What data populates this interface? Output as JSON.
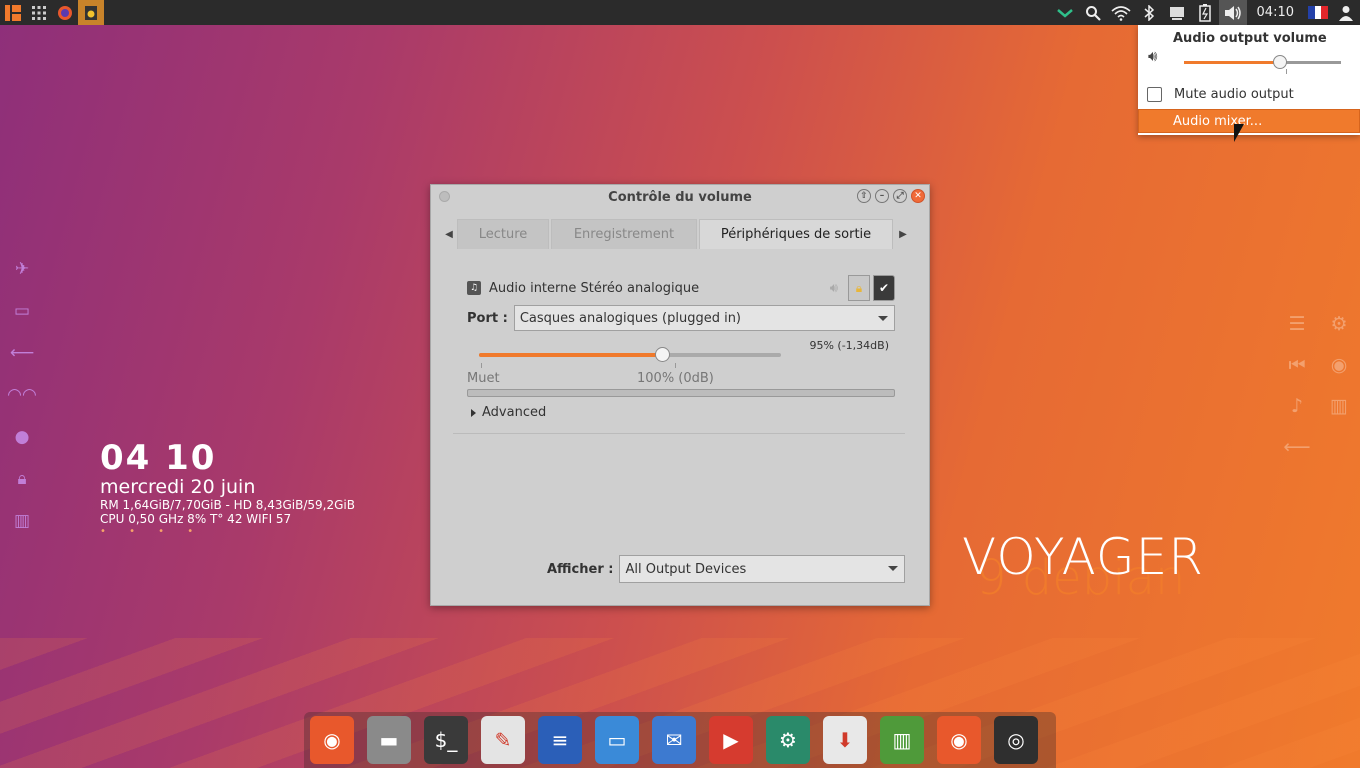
{
  "panel": {
    "clock": "04:10",
    "left_icons": [
      "menu-logo-icon",
      "app-grid-icon",
      "firefox-icon",
      "audio-app-icon"
    ],
    "right_icons": [
      "vpn-check-icon",
      "search-icon",
      "wifi-icon",
      "bluetooth-icon",
      "display-icon",
      "battery-icon",
      "volume-icon"
    ]
  },
  "left_sidebar": {
    "icons": [
      "airplane-icon",
      "monitor-icon",
      "arrow-left-icon",
      "mask-icon",
      "globe-icon",
      "lock-icon",
      "chart-icon"
    ]
  },
  "conky": {
    "time": "04 10",
    "date": "mercredi 20 juin",
    "line1": "RM 1,64GiB/7,70GiB - HD 8,43GiB/59,2GiB",
    "line2": "CPU 0,50 GHz 8% T° 42  WIFI 57",
    "dots": "• • • •"
  },
  "right_sidebar": {
    "icons": [
      [
        "menu-icon",
        "gear-icon"
      ],
      [
        "skip-back-icon",
        "eye-icon"
      ],
      [
        "music-icon",
        "bars-icon"
      ],
      [
        "arrow-left-icon"
      ]
    ]
  },
  "voyager": {
    "line1": "VOYAGER",
    "line2": "9 debian"
  },
  "dock": {
    "apps": [
      {
        "name": "firefox",
        "color": "#e8582c",
        "glyph": "◉"
      },
      {
        "name": "files",
        "color": "#8a8a8a",
        "glyph": "▬"
      },
      {
        "name": "terminal",
        "color": "#3a3a3a",
        "glyph": "$_"
      },
      {
        "name": "text-editor",
        "color": "#e4e4e4",
        "glyph": "✎"
      },
      {
        "name": "writer",
        "color": "#2b5fb8",
        "glyph": "≡"
      },
      {
        "name": "window",
        "color": "#3a8ad8",
        "glyph": "▭"
      },
      {
        "name": "thunderbird",
        "color": "#3d7ad0",
        "glyph": "✉"
      },
      {
        "name": "youtube",
        "color": "#d63b2f",
        "glyph": "▶"
      },
      {
        "name": "settings-tool",
        "color": "#2a8a6a",
        "glyph": "⚙"
      },
      {
        "name": "installer",
        "color": "#e8e8e8",
        "glyph": "⬇"
      },
      {
        "name": "trash",
        "color": "#4f9a3a",
        "glyph": "▥"
      },
      {
        "name": "firefox-2",
        "color": "#e8582c",
        "glyph": "◉"
      },
      {
        "name": "speaker",
        "color": "#2f2f2f",
        "glyph": "◎"
      }
    ]
  },
  "window": {
    "title": "Contrôle du volume",
    "tabs": [
      "Lecture",
      "Enregistrement",
      "Périphériques de sortie"
    ],
    "device_name": "Audio interne Stéréo analogique",
    "port_label": "Port :",
    "port_value": "Casques analogiques (plugged in)",
    "volume_text": "95% (-1,34dB)",
    "volume_level": 0.61,
    "mark_mute": "Muet",
    "mark_100": "100% (0dB)",
    "advanced_label": "Advanced",
    "afficher_label": "Afficher :",
    "afficher_value": "All Output Devices"
  },
  "popup": {
    "title": "Audio output volume",
    "volume_level": 0.61,
    "mute_label": "Mute audio output",
    "mixer_label": "Audio mixer..."
  },
  "colors": {
    "accent": "#f07a2c",
    "panel_bg": "#2b2b2b",
    "window_bg": "#cfcfcf"
  }
}
